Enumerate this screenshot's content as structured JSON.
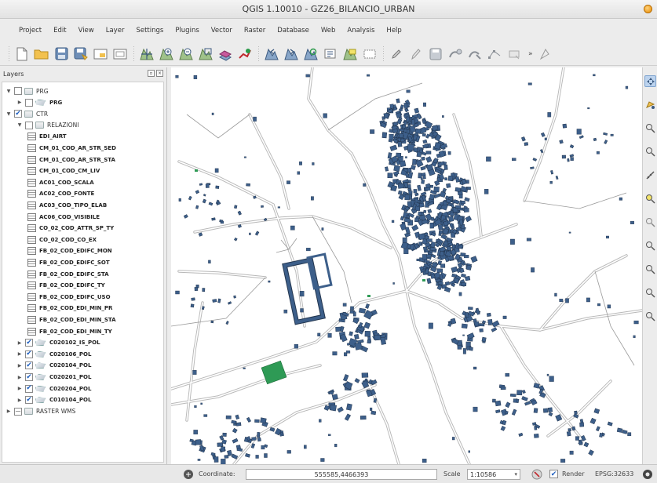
{
  "window": {
    "title": "QGIS 1.10010 - GZ26_BILANCIO_URBAN"
  },
  "menu": [
    "Project",
    "Edit",
    "View",
    "Layer",
    "Settings",
    "Plugins",
    "Vector",
    "Raster",
    "Database",
    "Web",
    "Analysis",
    "Help"
  ],
  "toolbar": {
    "more_label": "»"
  },
  "layers_panel": {
    "title": "Layers",
    "items": [
      {
        "label": "PRG",
        "level": 0,
        "kind": "group",
        "expanded": true,
        "checked": false
      },
      {
        "label": "PRG",
        "level": 1,
        "kind": "polygon",
        "expanded": false,
        "checked": false,
        "bold": true
      },
      {
        "label": "CTR",
        "level": 0,
        "kind": "group",
        "expanded": true,
        "checked": true
      },
      {
        "label": "RELAZIONI",
        "level": 1,
        "kind": "group",
        "expanded": true,
        "checked": false
      },
      {
        "label": "EDI_AIRT",
        "level": 2,
        "kind": "table",
        "bold": true
      },
      {
        "label": "CM_01_COD_AR_STR_SED",
        "level": 2,
        "kind": "table",
        "bold": true
      },
      {
        "label": "CM_01_COD_AR_STR_STA",
        "level": 2,
        "kind": "table",
        "bold": true
      },
      {
        "label": "CM_01_COD_CM_LIV",
        "level": 2,
        "kind": "table",
        "bold": true
      },
      {
        "label": "AC01_COD_SCALA",
        "level": 2,
        "kind": "table",
        "bold": true
      },
      {
        "label": "AC02_COD_FONTE",
        "level": 2,
        "kind": "table",
        "bold": true
      },
      {
        "label": "AC03_COD_TIPO_ELAB",
        "level": 2,
        "kind": "table",
        "bold": true
      },
      {
        "label": "AC06_COD_VISIBILE",
        "level": 2,
        "kind": "table",
        "bold": true
      },
      {
        "label": "CO_02_COD_ATTR_SP_TY",
        "level": 2,
        "kind": "table",
        "bold": true
      },
      {
        "label": "CO_02_COD_CO_EX",
        "level": 2,
        "kind": "table",
        "bold": true
      },
      {
        "label": "FB_02_COD_EDIFC_MON",
        "level": 2,
        "kind": "table",
        "bold": true
      },
      {
        "label": "FB_02_COD_EDIFC_SOT",
        "level": 2,
        "kind": "table",
        "bold": true
      },
      {
        "label": "FB_02_COD_EDIFC_STA",
        "level": 2,
        "kind": "table",
        "bold": true
      },
      {
        "label": "FB_02_COD_EDIFC_TY",
        "level": 2,
        "kind": "table",
        "bold": true
      },
      {
        "label": "FB_02_COD_EDIFC_USO",
        "level": 2,
        "kind": "table",
        "bold": true
      },
      {
        "label": "FB_02_COD_EDI_MIN_PR",
        "level": 2,
        "kind": "table",
        "bold": true
      },
      {
        "label": "FB_02_COD_EDI_MIN_STA",
        "level": 2,
        "kind": "table",
        "bold": true
      },
      {
        "label": "FB_02_COD_EDI_MIN_TY",
        "level": 2,
        "kind": "table",
        "bold": true
      },
      {
        "label": "C020102_IS_POL",
        "level": 1,
        "kind": "polygon",
        "expanded": false,
        "checked": true,
        "bold": true
      },
      {
        "label": "C020106_POL",
        "level": 1,
        "kind": "polygon",
        "expanded": false,
        "checked": true,
        "bold": true
      },
      {
        "label": "C020104_POL",
        "level": 1,
        "kind": "polygon",
        "expanded": false,
        "checked": true,
        "bold": true
      },
      {
        "label": "C020201_POL",
        "level": 1,
        "kind": "polygon",
        "expanded": false,
        "checked": true,
        "bold": true
      },
      {
        "label": "C020204_POL",
        "level": 1,
        "kind": "polygon",
        "expanded": false,
        "checked": true,
        "bold": true
      },
      {
        "label": "C010104_POL",
        "level": 1,
        "kind": "polygon",
        "expanded": false,
        "checked": true,
        "bold": true
      },
      {
        "label": "RASTER WMS",
        "level": 0,
        "kind": "group",
        "expanded": false,
        "checked": false,
        "partial": true
      }
    ]
  },
  "status": {
    "coordinate_label": "Coordinate:",
    "coordinate_value": "555585,4466393",
    "scale_label": "Scale",
    "scale_value": "1:10586",
    "render_label": "Render",
    "crs": "EPSG:32633"
  },
  "colors": {
    "building": "#3d5f8a",
    "building_stroke": "#23364f",
    "road": "#b8b8b8",
    "green_area": "#2e9a55",
    "panel_bg": "#ececec"
  }
}
